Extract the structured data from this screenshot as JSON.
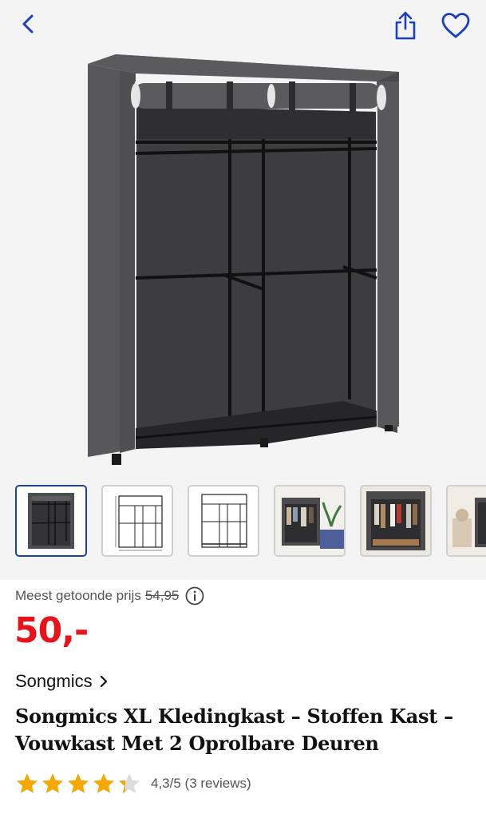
{
  "header": {
    "back_icon": "chevron-left-icon",
    "share_icon": "share-icon",
    "favorite_icon": "heart-icon",
    "accent_color": "#1a3fbf"
  },
  "gallery": {
    "main_image": "grey fabric wardrobe with roll-up doors",
    "thumbnails": [
      {
        "label": "product-photo",
        "selected": true
      },
      {
        "label": "dimension-drawing",
        "selected": false
      },
      {
        "label": "frame-drawing",
        "selected": false
      },
      {
        "label": "bedroom-scene",
        "selected": false
      },
      {
        "label": "open-wardrobe-scene",
        "selected": false
      },
      {
        "label": "room-scene-partial",
        "selected": false
      }
    ]
  },
  "pricing": {
    "label": "Meest getoonde prijs",
    "old_price": "54,95",
    "current_price": "50,-",
    "price_color": "#e8121b"
  },
  "product": {
    "brand": "Songmics",
    "title": "Songmics XL Kledingkast – Stoffen Kast – Vouwkast Met 2 Oprolbare Deuren"
  },
  "rating": {
    "score": 4.3,
    "max": 5,
    "text": "4,3/5 (3 reviews)",
    "star_color": "#f5a800"
  }
}
